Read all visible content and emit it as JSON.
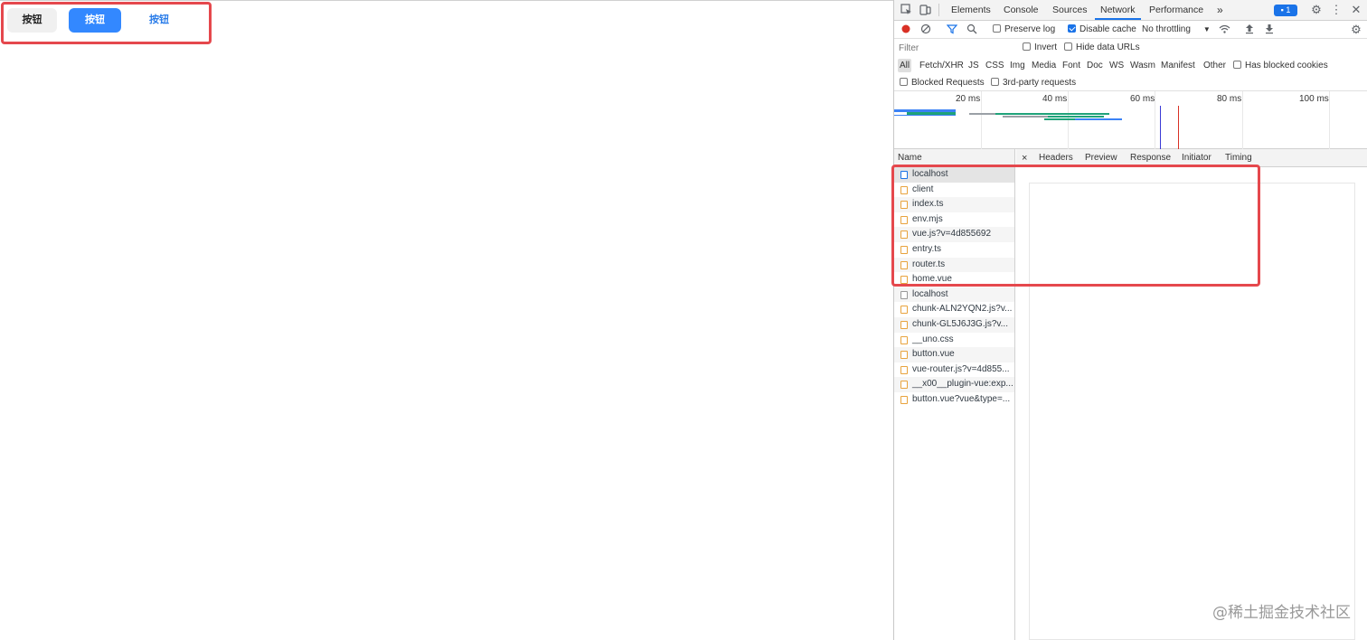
{
  "page": {
    "buttons": [
      {
        "label": "按钮",
        "variant": "default"
      },
      {
        "label": "按钮",
        "variant": "primary"
      },
      {
        "label": "按钮",
        "variant": "text"
      }
    ]
  },
  "devtools": {
    "tabs": [
      "Elements",
      "Console",
      "Sources",
      "Network",
      "Performance"
    ],
    "active_tab": "Network",
    "more_tabs": "»",
    "issues_count": "1",
    "toolbar": {
      "preserve_log": "Preserve log",
      "disable_cache": "Disable cache",
      "throttling": "No throttling"
    },
    "filter": {
      "placeholder": "Filter",
      "invert": "Invert",
      "hide_data_urls": "Hide data URLs"
    },
    "types": [
      "All",
      "Fetch/XHR",
      "JS",
      "CSS",
      "Img",
      "Media",
      "Font",
      "Doc",
      "WS",
      "Wasm",
      "Manifest",
      "Other"
    ],
    "has_blocked_cookies": "Has blocked cookies",
    "blocked_requests": "Blocked Requests",
    "third_party": "3rd-party requests",
    "timeline_labels": [
      "20 ms",
      "40 ms",
      "60 ms",
      "80 ms",
      "100 ms"
    ],
    "name_header": "Name",
    "requests": [
      {
        "name": "localhost",
        "type": "doc"
      },
      {
        "name": "client",
        "type": "script"
      },
      {
        "name": "index.ts",
        "type": "script"
      },
      {
        "name": "env.mjs",
        "type": "script"
      },
      {
        "name": "vue.js?v=4d855692",
        "type": "script"
      },
      {
        "name": "entry.ts",
        "type": "script"
      },
      {
        "name": "router.ts",
        "type": "script"
      },
      {
        "name": "home.vue",
        "type": "script"
      },
      {
        "name": "localhost",
        "type": "plain"
      },
      {
        "name": "chunk-ALN2YQN2.js?v...",
        "type": "script"
      },
      {
        "name": "chunk-GL5J6J3G.js?v...",
        "type": "script"
      },
      {
        "name": "__uno.css",
        "type": "script"
      },
      {
        "name": "button.vue",
        "type": "script"
      },
      {
        "name": "vue-router.js?v=4d855...",
        "type": "script"
      },
      {
        "name": "__x00__plugin-vue:exp...",
        "type": "script"
      },
      {
        "name": "button.vue?vue&type=...",
        "type": "script"
      }
    ],
    "detail_tabs": [
      "Headers",
      "Preview",
      "Response",
      "Initiator",
      "Timing"
    ],
    "active_detail_tab": "Preview",
    "close_glyph": "×"
  },
  "watermark": "@稀土掘金技术社区",
  "colors": {
    "primary": "#3388ff",
    "highlight": "#e5484d",
    "devtools_accent": "#1a73e8"
  }
}
